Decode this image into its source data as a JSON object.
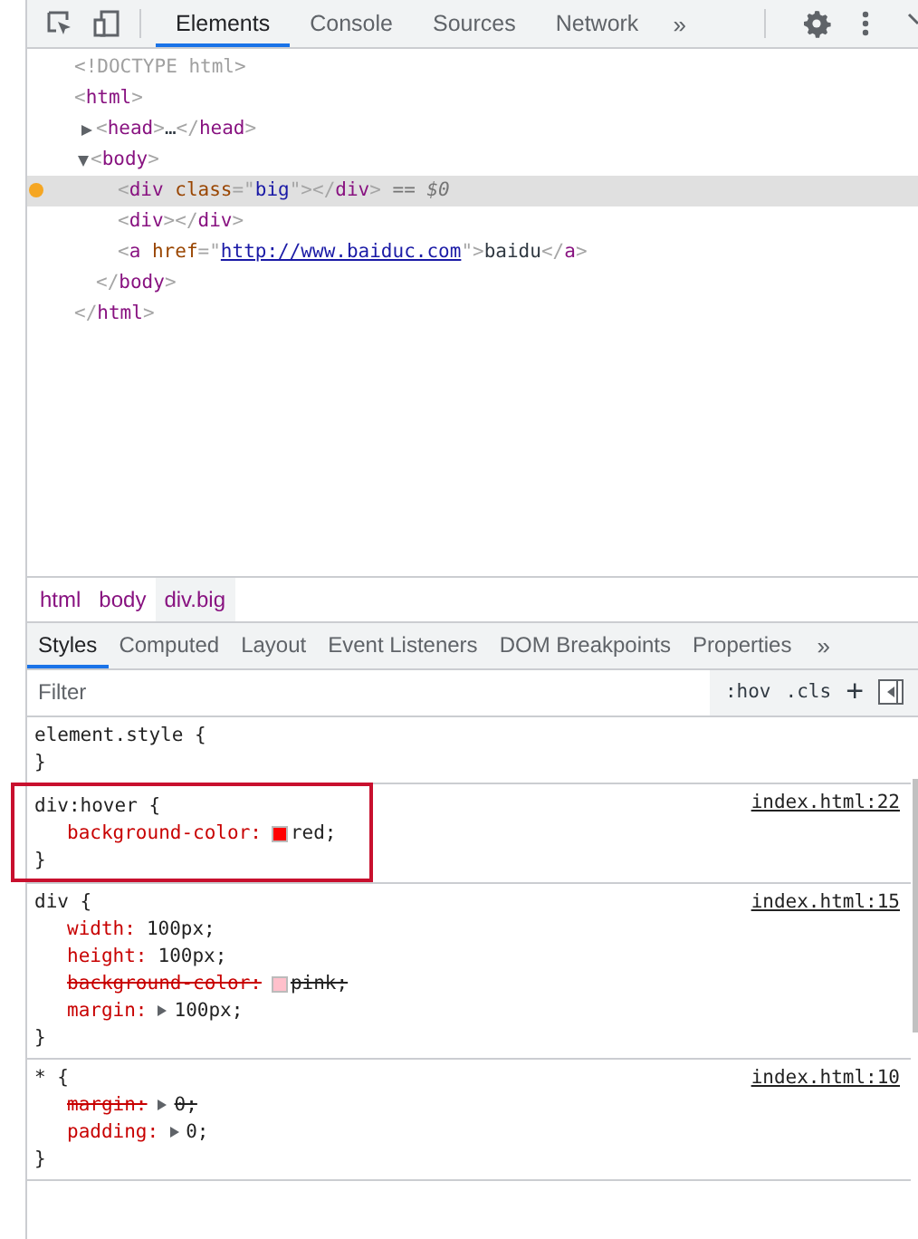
{
  "toolbar": {
    "tabs": [
      {
        "label": "Elements",
        "selected": true
      },
      {
        "label": "Console",
        "selected": false
      },
      {
        "label": "Sources",
        "selected": false
      },
      {
        "label": "Network",
        "selected": false
      }
    ],
    "overflow": "»"
  },
  "dom_tree": [
    {
      "selected": false,
      "marked": false,
      "parts": [
        {
          "kind": "doctype",
          "text": "<!DOCTYPE html>"
        }
      ]
    },
    {
      "selected": false,
      "marked": false,
      "parts": [
        {
          "kind": "bracket",
          "text": "<"
        },
        {
          "kind": "tag",
          "text": "html"
        },
        {
          "kind": "bracket",
          "text": ">"
        }
      ],
      "close": [
        {
          "kind": "bracket",
          "text": "</"
        },
        {
          "kind": "tag",
          "text": "html"
        },
        {
          "kind": "bracket",
          "text": ">"
        }
      ],
      "children": [
        {
          "selected": false,
          "marked": false,
          "expanded": false,
          "parts": [
            {
              "kind": "bracket",
              "text": "<"
            },
            {
              "kind": "tag",
              "text": "head"
            },
            {
              "kind": "bracket",
              "text": ">"
            },
            {
              "kind": "text",
              "text": "…"
            },
            {
              "kind": "bracket",
              "text": "</"
            },
            {
              "kind": "tag",
              "text": "head"
            },
            {
              "kind": "bracket",
              "text": ">"
            }
          ]
        },
        {
          "selected": false,
          "marked": false,
          "expanded": true,
          "parts": [
            {
              "kind": "bracket",
              "text": "<"
            },
            {
              "kind": "tag",
              "text": "body"
            },
            {
              "kind": "bracket",
              "text": ">"
            }
          ],
          "close": [
            {
              "kind": "bracket",
              "text": "</"
            },
            {
              "kind": "tag",
              "text": "body"
            },
            {
              "kind": "bracket",
              "text": ">"
            }
          ],
          "children": [
            {
              "selected": true,
              "marked": true,
              "parts": [
                {
                  "kind": "bracket",
                  "text": "<"
                },
                {
                  "kind": "tag",
                  "text": "div"
                },
                {
                  "kind": "attr",
                  "text": " class"
                },
                {
                  "kind": "bracket",
                  "text": "=\""
                },
                {
                  "kind": "value",
                  "text": "big"
                },
                {
                  "kind": "bracket",
                  "text": "\"></"
                },
                {
                  "kind": "tag",
                  "text": "div"
                },
                {
                  "kind": "bracket",
                  "text": ">"
                },
                {
                  "kind": "hint",
                  "text": " == $0"
                }
              ]
            },
            {
              "selected": false,
              "marked": false,
              "parts": [
                {
                  "kind": "bracket",
                  "text": "<"
                },
                {
                  "kind": "tag",
                  "text": "div"
                },
                {
                  "kind": "bracket",
                  "text": "></"
                },
                {
                  "kind": "tag",
                  "text": "div"
                },
                {
                  "kind": "bracket",
                  "text": ">"
                }
              ]
            },
            {
              "selected": false,
              "marked": false,
              "parts": [
                {
                  "kind": "bracket",
                  "text": "<"
                },
                {
                  "kind": "tag",
                  "text": "a"
                },
                {
                  "kind": "attr",
                  "text": " href"
                },
                {
                  "kind": "bracket",
                  "text": "=\""
                },
                {
                  "kind": "link",
                  "text": "http://www.baiduc.com"
                },
                {
                  "kind": "bracket",
                  "text": "\">"
                },
                {
                  "kind": "text",
                  "text": "baidu"
                },
                {
                  "kind": "bracket",
                  "text": "</"
                },
                {
                  "kind": "tag",
                  "text": "a"
                },
                {
                  "kind": "bracket",
                  "text": ">"
                }
              ]
            }
          ]
        }
      ]
    }
  ],
  "breadcrumbs": [
    {
      "label": "html",
      "selected": false
    },
    {
      "label": "body",
      "selected": false
    },
    {
      "label": "div.big",
      "selected": true
    }
  ],
  "sidebar_tabs": [
    {
      "label": "Styles",
      "selected": true
    },
    {
      "label": "Computed",
      "selected": false
    },
    {
      "label": "Layout",
      "selected": false
    },
    {
      "label": "Event Listeners",
      "selected": false
    },
    {
      "label": "DOM Breakpoints",
      "selected": false
    },
    {
      "label": "Properties",
      "selected": false
    }
  ],
  "sidebar_overflow": "»",
  "filter": {
    "placeholder": "Filter",
    "hov": ":hov",
    "cls": ".cls",
    "add": "+"
  },
  "rules": [
    {
      "selector": "element.style {",
      "close": "}",
      "highlighted": false
    },
    {
      "selector": "div:hover {",
      "close": "}",
      "source": "index.html:22",
      "highlighted": true,
      "declarations": [
        {
          "property": "background-color:",
          "value": "red;",
          "struck": false,
          "color": "#ff0000"
        }
      ]
    },
    {
      "selector": "div {",
      "close": "}",
      "source": "index.html:15",
      "highlighted": false,
      "declarations": [
        {
          "property": "width:",
          "value": "100px;",
          "struck": false
        },
        {
          "property": "height:",
          "value": "100px;",
          "struck": false
        },
        {
          "property": "background-color:",
          "value": "pink;",
          "struck": true,
          "color": "#ffc0cb"
        },
        {
          "property": "margin:",
          "value": "100px;",
          "struck": false,
          "expandable": true
        }
      ]
    },
    {
      "selector": "* {",
      "close": "}",
      "source": "index.html:10",
      "highlighted": false,
      "declarations": [
        {
          "property": "margin:",
          "value": "0;",
          "struck": true,
          "expandable": true
        },
        {
          "property": "padding:",
          "value": "0;",
          "struck": false,
          "expandable": true
        }
      ]
    }
  ]
}
